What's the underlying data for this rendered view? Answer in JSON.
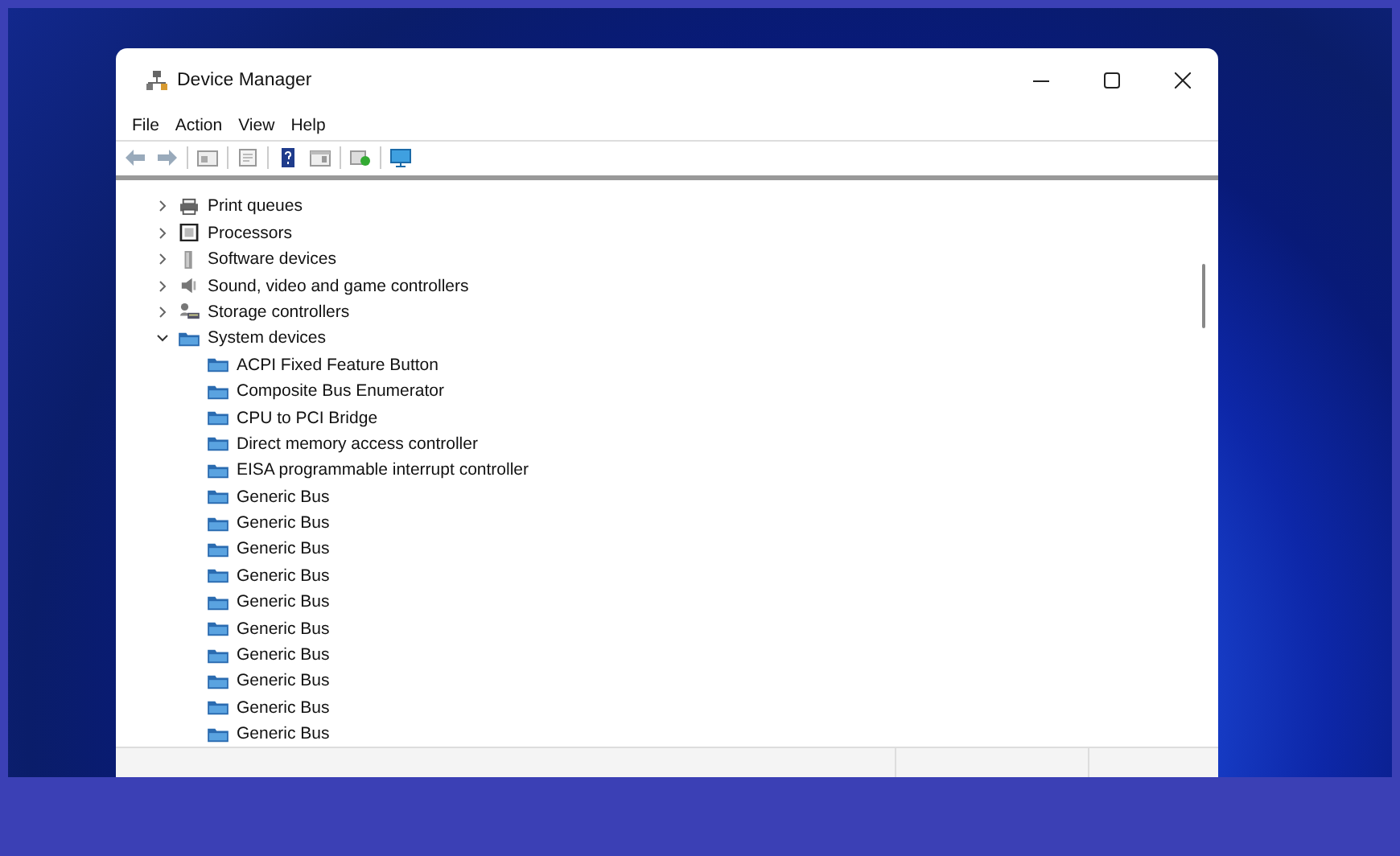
{
  "window": {
    "title": "Device Manager"
  },
  "menu": [
    {
      "label": "File"
    },
    {
      "label": "Action"
    },
    {
      "label": "View"
    },
    {
      "label": "Help"
    }
  ],
  "tree": [
    {
      "label": "Print queues",
      "kind": "printer",
      "expanded": false
    },
    {
      "label": "Processors",
      "kind": "chip",
      "expanded": false
    },
    {
      "label": "Software devices",
      "kind": "software",
      "expanded": false
    },
    {
      "label": "Sound, video and game controllers",
      "kind": "speaker",
      "expanded": false
    },
    {
      "label": "Storage controllers",
      "kind": "storage",
      "expanded": false
    },
    {
      "label": "System devices",
      "kind": "folder",
      "expanded": true,
      "children": [
        {
          "label": "ACPI Fixed Feature Button",
          "kind": "folder"
        },
        {
          "label": "Composite Bus Enumerator",
          "kind": "folder"
        },
        {
          "label": "CPU to PCI Bridge",
          "kind": "folder"
        },
        {
          "label": "Direct memory access controller",
          "kind": "folder"
        },
        {
          "label": "EISA programmable interrupt controller",
          "kind": "folder"
        },
        {
          "label": "Generic Bus",
          "kind": "folder"
        },
        {
          "label": "Generic Bus",
          "kind": "folder"
        },
        {
          "label": "Generic Bus",
          "kind": "folder"
        },
        {
          "label": "Generic Bus",
          "kind": "folder"
        },
        {
          "label": "Generic Bus",
          "kind": "folder"
        },
        {
          "label": "Generic Bus",
          "kind": "folder"
        },
        {
          "label": "Generic Bus",
          "kind": "folder"
        },
        {
          "label": "Generic Bus",
          "kind": "folder"
        },
        {
          "label": "Generic Bus",
          "kind": "folder"
        },
        {
          "label": "Generic Bus",
          "kind": "folder"
        }
      ]
    }
  ]
}
